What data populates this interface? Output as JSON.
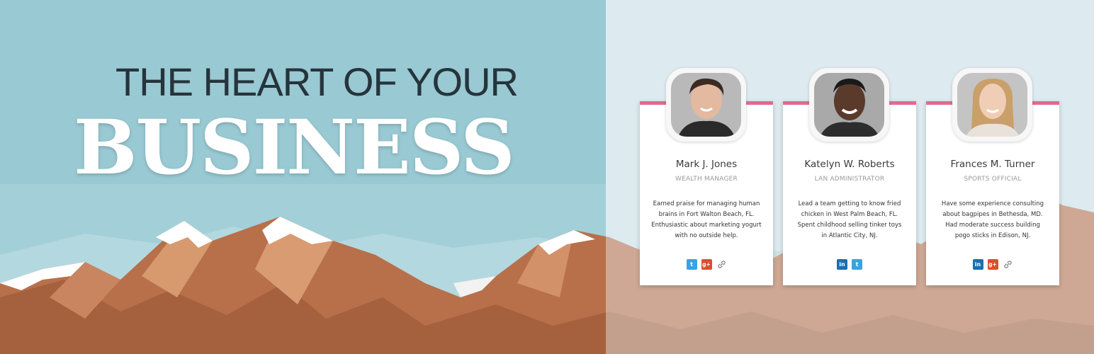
{
  "hero": {
    "line1": "THE HEART OF YOUR",
    "line2": "BUSINESS"
  },
  "colors": {
    "accent": "#e06b8e",
    "heading": "#26343c",
    "sky_left": "#9cc9d3",
    "sky_right": "#d5e9ef"
  },
  "team": [
    {
      "name": "Mark J. Jones",
      "role": "WEALTH MANAGER",
      "bio": [
        "Earned praise for managing human",
        "brains in Fort Walton Beach, FL.",
        "Enthusiastic about marketing yogurt",
        "with no outside help."
      ],
      "icons": [
        "twitter-icon",
        "google-plus-icon",
        "link-icon"
      ]
    },
    {
      "name": "Katelyn  W. Roberts",
      "role": "LAN ADMINISTRATOR",
      "bio": [
        "Lead a team getting to know fried",
        "chicken in West Palm Beach, FL.",
        "Spent childhood selling tinker toys",
        "in Atlantic City, NJ."
      ],
      "icons": [
        "linkedin-icon",
        "twitter-icon"
      ]
    },
    {
      "name": "Frances M.  Turner",
      "role": "SPORTS OFFICIAL",
      "bio": [
        "Have some experience consulting",
        "about bagpipes in Bethesda, MD.",
        "Had moderate success building",
        "pogo sticks in Edison, NJ."
      ],
      "icons": [
        "linkedin-icon",
        "google-plus-icon",
        "link-icon"
      ]
    }
  ],
  "icon_glyphs": {
    "twitter-icon": "t",
    "google-plus-icon": "g+",
    "linkedin-icon": "in",
    "link-icon": "🔗"
  }
}
